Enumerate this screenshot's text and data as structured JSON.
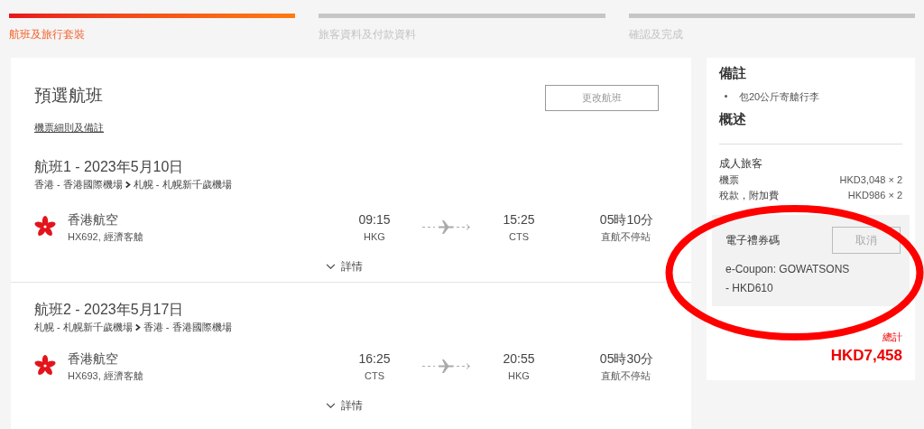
{
  "steps": [
    {
      "label": "航班及旅行套裝",
      "selected": true
    },
    {
      "label": "旅客資料及付款資料",
      "selected": false
    },
    {
      "label": "確認及完成",
      "selected": false
    }
  ],
  "main": {
    "title": "預選航班",
    "rules_link": "機票細則及備註",
    "change_button": "更改航班"
  },
  "flights": [
    {
      "heading": "航班1 - 2023年5月10日",
      "from": "香港 - 香港國際機場",
      "to": "札幌 - 札幌新千歲機場",
      "airline": "香港航空",
      "flight_info": "HX692, 經濟客艙",
      "dep_time": "09:15",
      "dep_code": "HKG",
      "arr_time": "15:25",
      "arr_code": "CTS",
      "duration": "05時10分",
      "stops": "直航不停站",
      "details": "詳情"
    },
    {
      "heading": "航班2 - 2023年5月17日",
      "from": "札幌 - 札幌新千歲機場",
      "to": "香港 - 香港國際機場",
      "airline": "香港航空",
      "flight_info": "HX693, 經濟客艙",
      "dep_time": "16:25",
      "dep_code": "CTS",
      "arr_time": "20:55",
      "arr_code": "HKG",
      "duration": "05時30分",
      "stops": "直航不停站",
      "details": "詳情"
    }
  ],
  "sidebar": {
    "notes_title": "備註",
    "notes": [
      "包20公斤寄艙行李"
    ],
    "summary_title": "概述",
    "passenger_type": "成人旅客",
    "price_rows": [
      {
        "label": "機票",
        "value": "HKD3,048 × 2"
      },
      {
        "label": "稅款，附加費",
        "value": "HKD986 × 2"
      }
    ],
    "coupon": {
      "title": "電子禮券碼",
      "cancel_button": "取消",
      "line_1": "e-Coupon: GOWATSONS",
      "line_2": "- HKD610"
    },
    "total_label": "總計",
    "total": "HKD7,458"
  }
}
